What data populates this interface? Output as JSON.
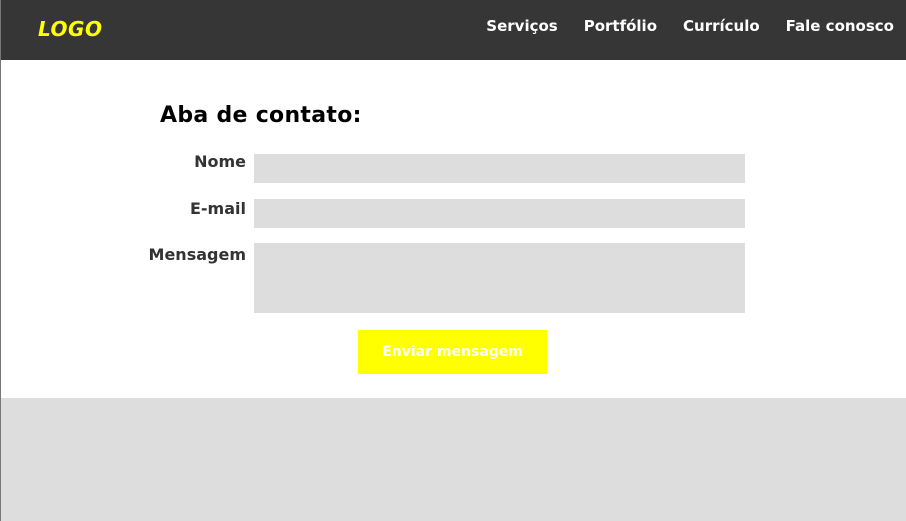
{
  "header": {
    "logo_text": "LOGO",
    "nav": [
      {
        "label": "Serviços"
      },
      {
        "label": "Portfólio"
      },
      {
        "label": "Currículo"
      },
      {
        "label": "Fale conosco"
      }
    ]
  },
  "contact_form": {
    "title": "Aba de contato:",
    "fields": {
      "name_label": "Nome",
      "email_label": "E-mail",
      "message_label": "Mensagem"
    },
    "submit_label": "Enviar mensagem"
  },
  "colors": {
    "header_bg": "#363636",
    "logo": "#ffff00",
    "nav_text": "#ffffff",
    "input_bg": "#dddddd",
    "button_bg": "#ffff00",
    "footer_bg": "#dddddd"
  }
}
